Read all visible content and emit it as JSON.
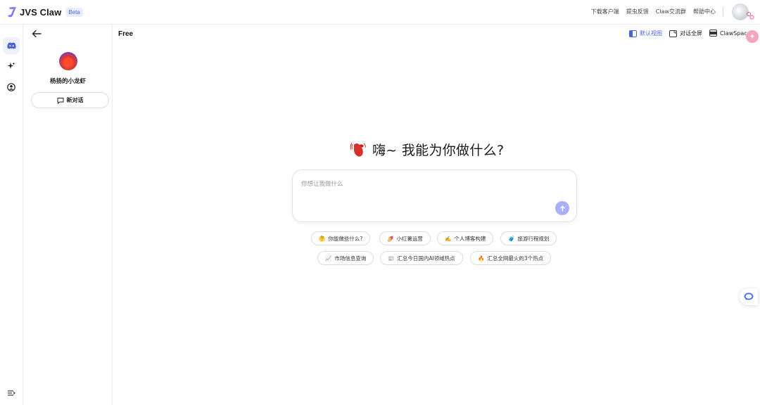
{
  "header": {
    "brand": "JVS Claw",
    "badge": "Beta",
    "links": [
      "下载客户端",
      "提虫反馈",
      "Claw交流群",
      "帮助中心"
    ],
    "avatar_badge": "🔗"
  },
  "rail": {
    "items": [
      {
        "icon": "discord-icon",
        "active": true
      },
      {
        "icon": "sparkle-icon",
        "active": false
      },
      {
        "icon": "user-circle-icon",
        "active": false
      }
    ],
    "collapse_icon": "collapse-icon"
  },
  "panel": {
    "agent_name": "杨扬的小龙虾",
    "new_chat_label": "新对话"
  },
  "main": {
    "plan": "Free",
    "views": [
      {
        "label": "默认视图",
        "active": true
      },
      {
        "label": "对话全屏",
        "active": false
      },
      {
        "label": "ClawSpace",
        "active": false
      }
    ],
    "greeting": "嗨~ 我能为你做什么?",
    "composer_placeholder": "你想让我做什么",
    "suggestions": [
      {
        "emoji": "🤔",
        "label": "你能做些什么?"
      },
      {
        "emoji": "🍠",
        "label": "小红薯运营"
      },
      {
        "emoji": "✍️",
        "label": "个人博客构建"
      },
      {
        "emoji": "🧳",
        "label": "旅游行程规划"
      },
      {
        "emoji": "📈",
        "label": "市场信息查询"
      },
      {
        "emoji": "📰",
        "label": "汇总今日国内AI领域热点"
      },
      {
        "emoji": "🔥",
        "label": "汇总全网最火的3个热点"
      }
    ]
  },
  "colors": {
    "accent": "#4b63d9",
    "send_button": "#a9b1f5",
    "brand_mark": "#7b5cf5"
  }
}
